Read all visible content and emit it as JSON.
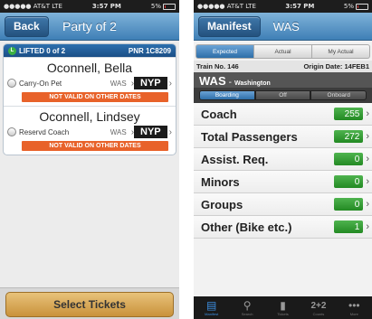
{
  "left": {
    "status": {
      "carrier": "●●●●● AT&T  LTE",
      "time": "3:57 PM",
      "battery": "5%"
    },
    "nav": {
      "back_label": "Back",
      "title": "Party of 2"
    },
    "card": {
      "lifted_label": "LIFTED 0 of 2",
      "pnr": "PNR 1C8209",
      "passengers": [
        {
          "name": "Oconnell, Bella",
          "type": "Carry-On Pet",
          "from": "WAS",
          "to": "NYP",
          "warning": "NOT VALID ON OTHER DATES"
        },
        {
          "name": "Oconnell, Lindsey",
          "type": "Reservd Coach",
          "from": "WAS",
          "to": "NYP",
          "warning": "NOT VALID ON OTHER DATES"
        }
      ]
    },
    "select_tickets_label": "Select Tickets"
  },
  "right": {
    "status": {
      "carrier": "●●●●● AT&T  LTE",
      "time": "3:57 PM",
      "battery": "5%"
    },
    "nav": {
      "back_label": "Manifest",
      "title": "WAS"
    },
    "top_segments": [
      "Expected",
      "Actual",
      "My Actual"
    ],
    "train": {
      "number": "Train No. 146",
      "origin": "Origin Date: 14FEB1"
    },
    "station": {
      "code": "WAS",
      "name": "Washington"
    },
    "boarding_segments": [
      "Boarding",
      "Off",
      "Onboard"
    ],
    "stats": [
      {
        "label": "Coach",
        "value": "255"
      },
      {
        "label": "Total Passengers",
        "value": "272"
      },
      {
        "label": "Assist. Req.",
        "value": "0"
      },
      {
        "label": "Minors",
        "value": "0"
      },
      {
        "label": "Groups",
        "value": "0"
      },
      {
        "label": "Other (Bike etc.)",
        "value": "1"
      }
    ],
    "tabs": [
      {
        "label": "Manifest",
        "icon": "list-icon"
      },
      {
        "label": "Search",
        "icon": "search-icon"
      },
      {
        "label": "Tickets",
        "icon": "ticket-icon"
      },
      {
        "label": "Counts",
        "icon": "plus-counts-icon",
        "text": "2+2"
      },
      {
        "label": "More",
        "icon": "more-icon"
      }
    ]
  }
}
